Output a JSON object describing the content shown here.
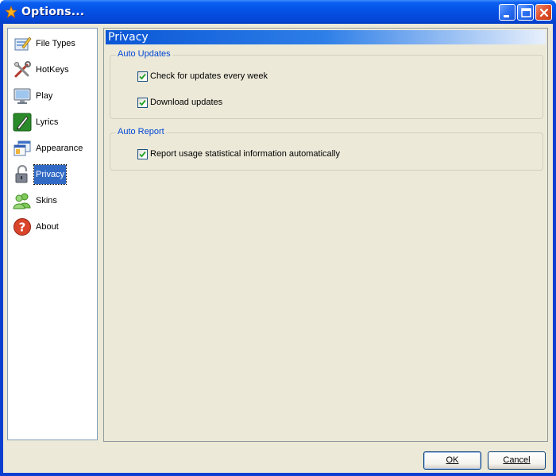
{
  "window": {
    "title": "Options..."
  },
  "sidebar": {
    "items": [
      {
        "label": "File Types",
        "icon": "file-types-icon"
      },
      {
        "label": "HotKeys",
        "icon": "hotkeys-icon"
      },
      {
        "label": "Play",
        "icon": "monitor-icon"
      },
      {
        "label": "Lyrics",
        "icon": "pen-icon"
      },
      {
        "label": "Appearance",
        "icon": "appearance-icon"
      },
      {
        "label": "Privacy",
        "icon": "padlock-icon",
        "selected": true
      },
      {
        "label": "Skins",
        "icon": "users-icon"
      },
      {
        "label": "About",
        "icon": "question-icon"
      }
    ]
  },
  "content": {
    "title": "Privacy",
    "groups": [
      {
        "title": "Auto Updates",
        "options": [
          {
            "label": "Check for updates every week",
            "checked": true
          },
          {
            "label": "Download updates",
            "checked": true
          }
        ]
      },
      {
        "title": "Auto Report",
        "options": [
          {
            "label": "Report usage statistical information automatically",
            "checked": true
          }
        ]
      }
    ]
  },
  "buttons": {
    "ok_label": "OK",
    "cancel_label": "Cancel"
  },
  "colors": {
    "title_bar": "#0551e6",
    "selection": "#316ac5",
    "group_title": "#0046d5",
    "dialog_bg": "#ece9d8"
  }
}
